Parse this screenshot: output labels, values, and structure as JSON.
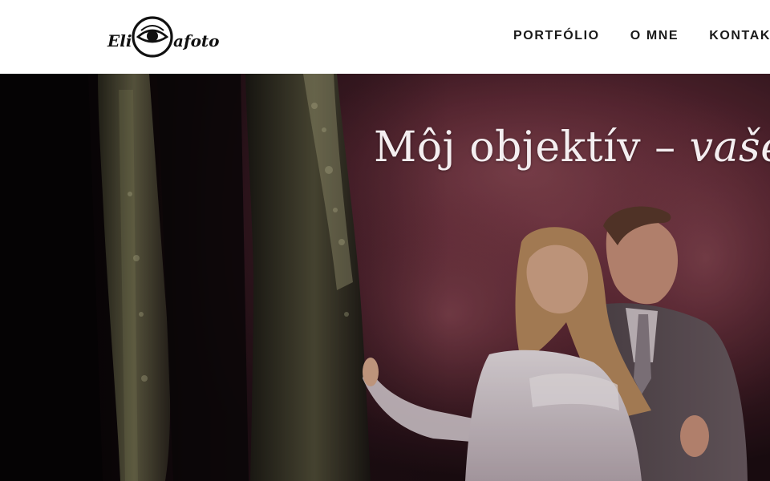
{
  "header": {
    "logo": {
      "alt": "Eli Rafoto"
    },
    "nav": [
      {
        "label": "PORTFÓLIO"
      },
      {
        "label": "O MNE"
      },
      {
        "label": "KONTAKT"
      }
    ]
  },
  "hero": {
    "title_main": "Môj objektív – ",
    "title_emph": "vaše s",
    "image_icon": "wedding-couple-forest-photo"
  },
  "colors": {
    "nav_text": "#1a1a1a",
    "hero_text": "#f4eef0",
    "hero_bg": "#1a0c10",
    "smoke": "#6e2f3c"
  }
}
